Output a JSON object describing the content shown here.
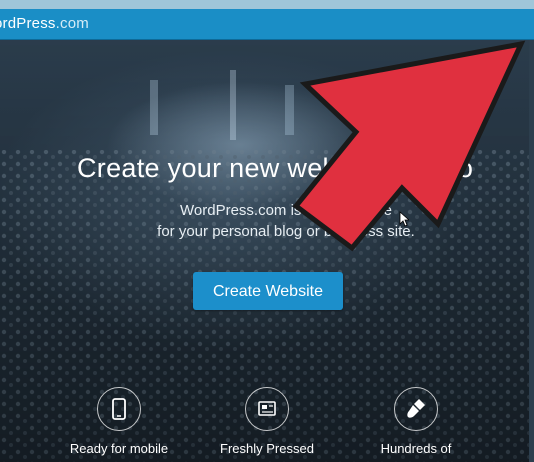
{
  "topbar": {
    "brand": "ordPress",
    "brand_suffix": ".com"
  },
  "hero": {
    "headline": "Create your new web",
    "headline_tail": "o",
    "subtitle_line1": "WordPress.com is th",
    "subtitle_line1_tail": "place",
    "subtitle_line2": "for your personal blog or business site.",
    "cta_label": "Create Website"
  },
  "features": [
    {
      "icon": "mobile-icon",
      "label": "Ready for mobile"
    },
    {
      "icon": "newspaper-icon",
      "label": "Freshly Pressed"
    },
    {
      "icon": "paintbrush-icon",
      "label": "Hundreds of"
    }
  ],
  "colors": {
    "topbar": "#1a8ec6",
    "cta": "#1c8fcb",
    "arrow": "#e0303f"
  }
}
